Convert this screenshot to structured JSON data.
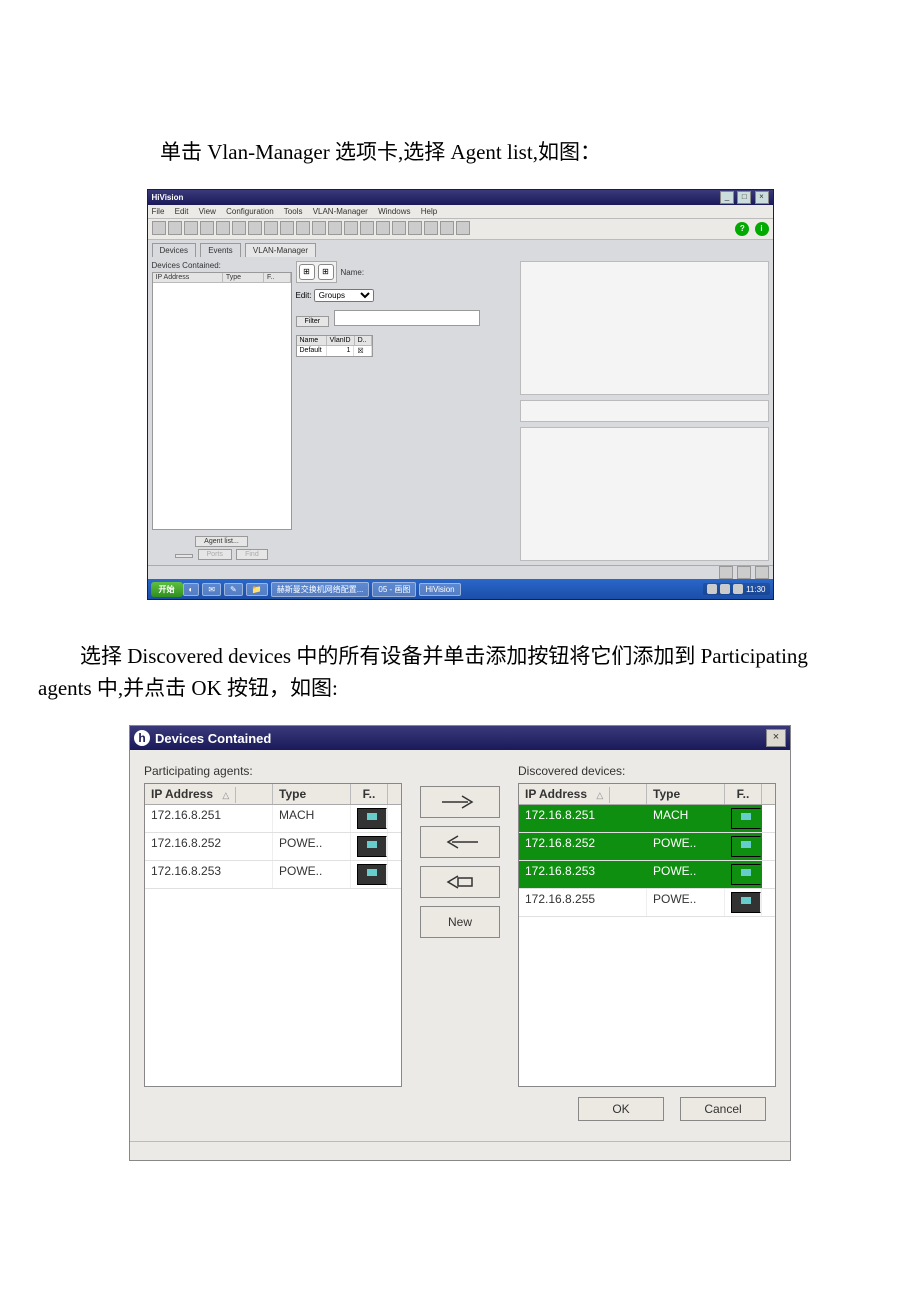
{
  "doc": {
    "para1": "单击 Vlan-Manager 选项卡,选择 Agent list,如图：",
    "para2": "选择 Discovered devices 中的所有设备并单击添加按钮将它们添加到 Participating agents 中,并点击 OK 按钮，如图:"
  },
  "fig1": {
    "title": "HiVision",
    "winbuttons": [
      "_",
      "□",
      "×"
    ],
    "menu": [
      "File",
      "Edit",
      "View",
      "Configuration",
      "Tools",
      "VLAN-Manager",
      "Windows",
      "Help"
    ],
    "help_icons": [
      "?",
      "i"
    ],
    "tabs": [
      "Devices",
      "Events",
      "VLAN-Manager"
    ],
    "active_tab": "VLAN-Manager",
    "left": {
      "header": "Devices Contained:",
      "cols": [
        "IP Address",
        "Type",
        "F.."
      ],
      "buttons": {
        "agent": "Agent list...",
        "b1": "",
        "b2": "Ports",
        "b3": "Find"
      }
    },
    "mid": {
      "name_lbl": "Name:",
      "edit_lbl": "Edit:",
      "edit_sel": "Groups",
      "filter_btn": "Filter",
      "vlan_cols": [
        "Name",
        "VlanID",
        "D.."
      ],
      "vlan_row": [
        "Default",
        "1",
        "☒"
      ]
    },
    "taskbar": {
      "start": "开始",
      "items": [
        "赫斯曼交换机网络配置...",
        "05 - 画图",
        "HiVision"
      ],
      "time": "11:30"
    }
  },
  "fig2": {
    "title": "Devices Contained",
    "left_label": "Participating agents:",
    "right_label": "Discovered devices:",
    "cols": [
      "IP Address",
      "Type",
      "F.."
    ],
    "participating": [
      {
        "ip": "172.16.8.251",
        "type": "MACH",
        "sel": false
      },
      {
        "ip": "172.16.8.252",
        "type": "POWE..",
        "sel": false
      },
      {
        "ip": "172.16.8.253",
        "type": "POWE..",
        "sel": false
      }
    ],
    "discovered": [
      {
        "ip": "172.16.8.251",
        "type": "MACH",
        "sel": true
      },
      {
        "ip": "172.16.8.252",
        "type": "POWE..",
        "sel": true
      },
      {
        "ip": "172.16.8.253",
        "type": "POWE..",
        "sel": true
      },
      {
        "ip": "172.16.8.255",
        "type": "POWE..",
        "sel": false
      }
    ],
    "buttons": {
      "new": "New",
      "ok": "OK",
      "cancel": "Cancel"
    }
  }
}
